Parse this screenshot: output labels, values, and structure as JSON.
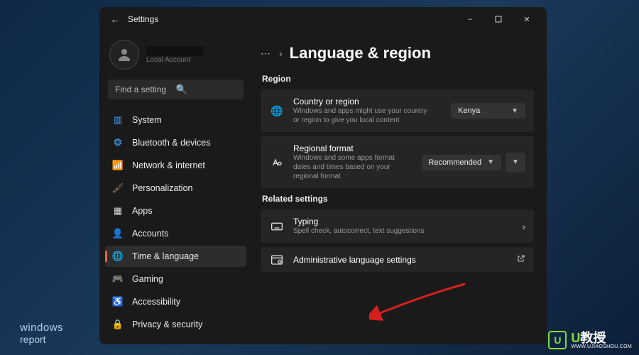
{
  "window": {
    "title": "Settings",
    "profile_sub": "Local Account",
    "search_placeholder": "Find a setting"
  },
  "sidebar": {
    "items": [
      {
        "label": "System"
      },
      {
        "label": "Bluetooth & devices"
      },
      {
        "label": "Network & internet"
      },
      {
        "label": "Personalization"
      },
      {
        "label": "Apps"
      },
      {
        "label": "Accounts"
      },
      {
        "label": "Time & language"
      },
      {
        "label": "Gaming"
      },
      {
        "label": "Accessibility"
      },
      {
        "label": "Privacy & security"
      }
    ]
  },
  "breadcrumb": {
    "title": "Language & region"
  },
  "region": {
    "heading": "Region",
    "country": {
      "title": "Country or region",
      "desc": "Windows and apps might use your country or region to give you local content",
      "value": "Kenya"
    },
    "format": {
      "title": "Regional format",
      "desc": "Windows and some apps format dates and times based on your regional format",
      "value": "Recommended"
    }
  },
  "related": {
    "heading": "Related settings",
    "typing": {
      "title": "Typing",
      "desc": "Spell check, autocorrect, text suggestions"
    },
    "admin": {
      "title": "Administrative language settings"
    }
  },
  "watermark_left": {
    "line1": "windows",
    "line2": "report"
  },
  "watermark_right": {
    "badge": "U",
    "t1": "U",
    "t2": "教授",
    "url": "WWW.UJIAOSHOU.COM"
  }
}
